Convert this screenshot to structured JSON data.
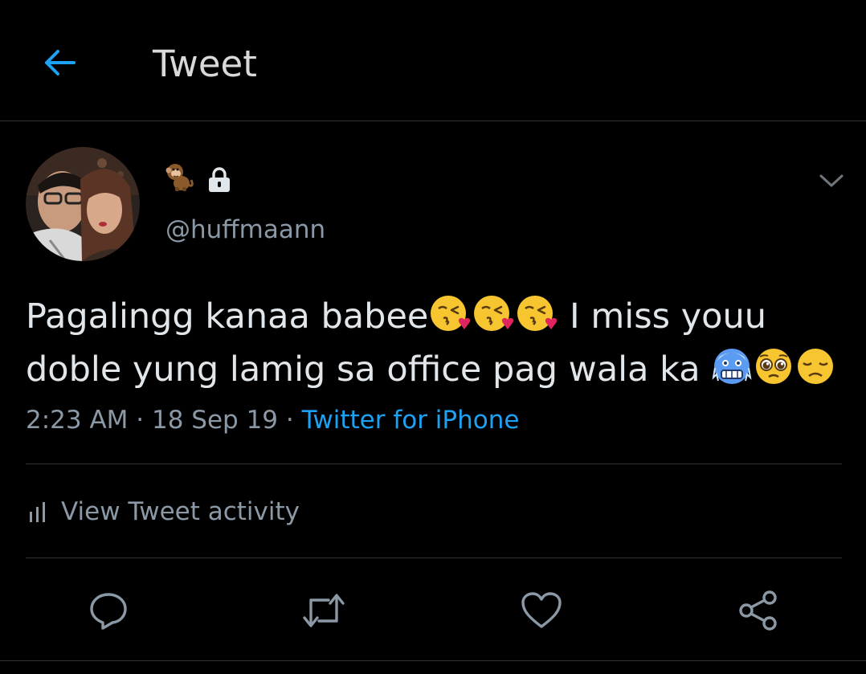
{
  "header": {
    "title": "Tweet"
  },
  "author": {
    "display_name_emoji": "🐒",
    "handle": "@huffmaann",
    "protected_icon": "lock-icon"
  },
  "tweet": {
    "line1_start": "Pagalingg kanaa babee",
    "line1_end": " I miss youu",
    "line2_start": "doble yung lamig sa office pag wala ka "
  },
  "meta": {
    "time": "2:23 AM",
    "separator": " · ",
    "date": "18 Sep 19",
    "source": "Twitter for iPhone"
  },
  "activity": {
    "label": "View Tweet activity"
  },
  "actions": [
    "reply-icon",
    "retweet-icon",
    "like-icon",
    "share-icon"
  ],
  "colors": {
    "background": "#000000",
    "accent": "#1da1f2",
    "text": "#e1e6ea",
    "muted": "#8b98a5",
    "divider": "#2f3336"
  }
}
